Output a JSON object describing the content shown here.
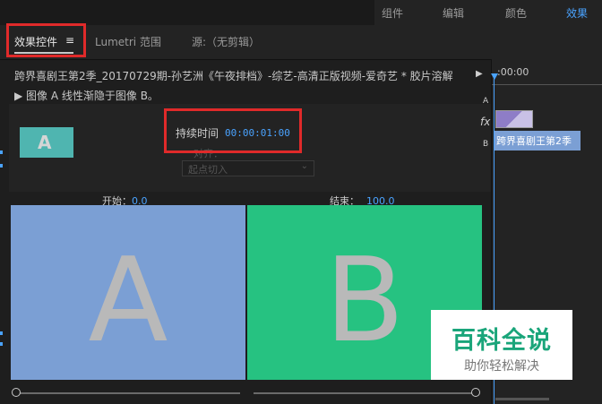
{
  "workspace": {
    "tabs": [
      "组件",
      "编辑",
      "颜色",
      "效果"
    ],
    "active": "效果"
  },
  "panel_tabs": {
    "effect_controls": "效果控件",
    "menu_icon": "≡",
    "lumetri": "Lumetri 范围",
    "source": "源:（无剪辑）"
  },
  "clip_line": "跨界喜剧王第2季_20170729期-孙艺洲《午夜排档》-综艺-高清正版视频-爱奇艺 * 胶片溶解",
  "effect_description": "▶  图像 A 线性渐隐于图像 B。",
  "controls": {
    "thumb_letter": "A",
    "duration_label": "持续时间",
    "duration_value": "00:00:01:00",
    "align_label": "对齐：",
    "align_value": "起点切入"
  },
  "start": {
    "label": "开始：",
    "value": "0.0"
  },
  "end": {
    "label": "结束：",
    "value": "100.0"
  },
  "preview": {
    "a_letter": "A",
    "b_letter": "B"
  },
  "timeline": {
    "time": ":00:00",
    "track_a": "A",
    "track_b": "B",
    "fx": "fx",
    "clip_label": "跨界喜剧王第2季"
  },
  "watermark": {
    "title": "百科全说",
    "subtitle": "助你轻松解决"
  },
  "colors": {
    "accent_blue": "#4aa3ff",
    "highlight_red": "#e02a2a",
    "preview_a": "#7b9fd4",
    "preview_b": "#26c281",
    "watermark_green": "#1aa57a"
  }
}
